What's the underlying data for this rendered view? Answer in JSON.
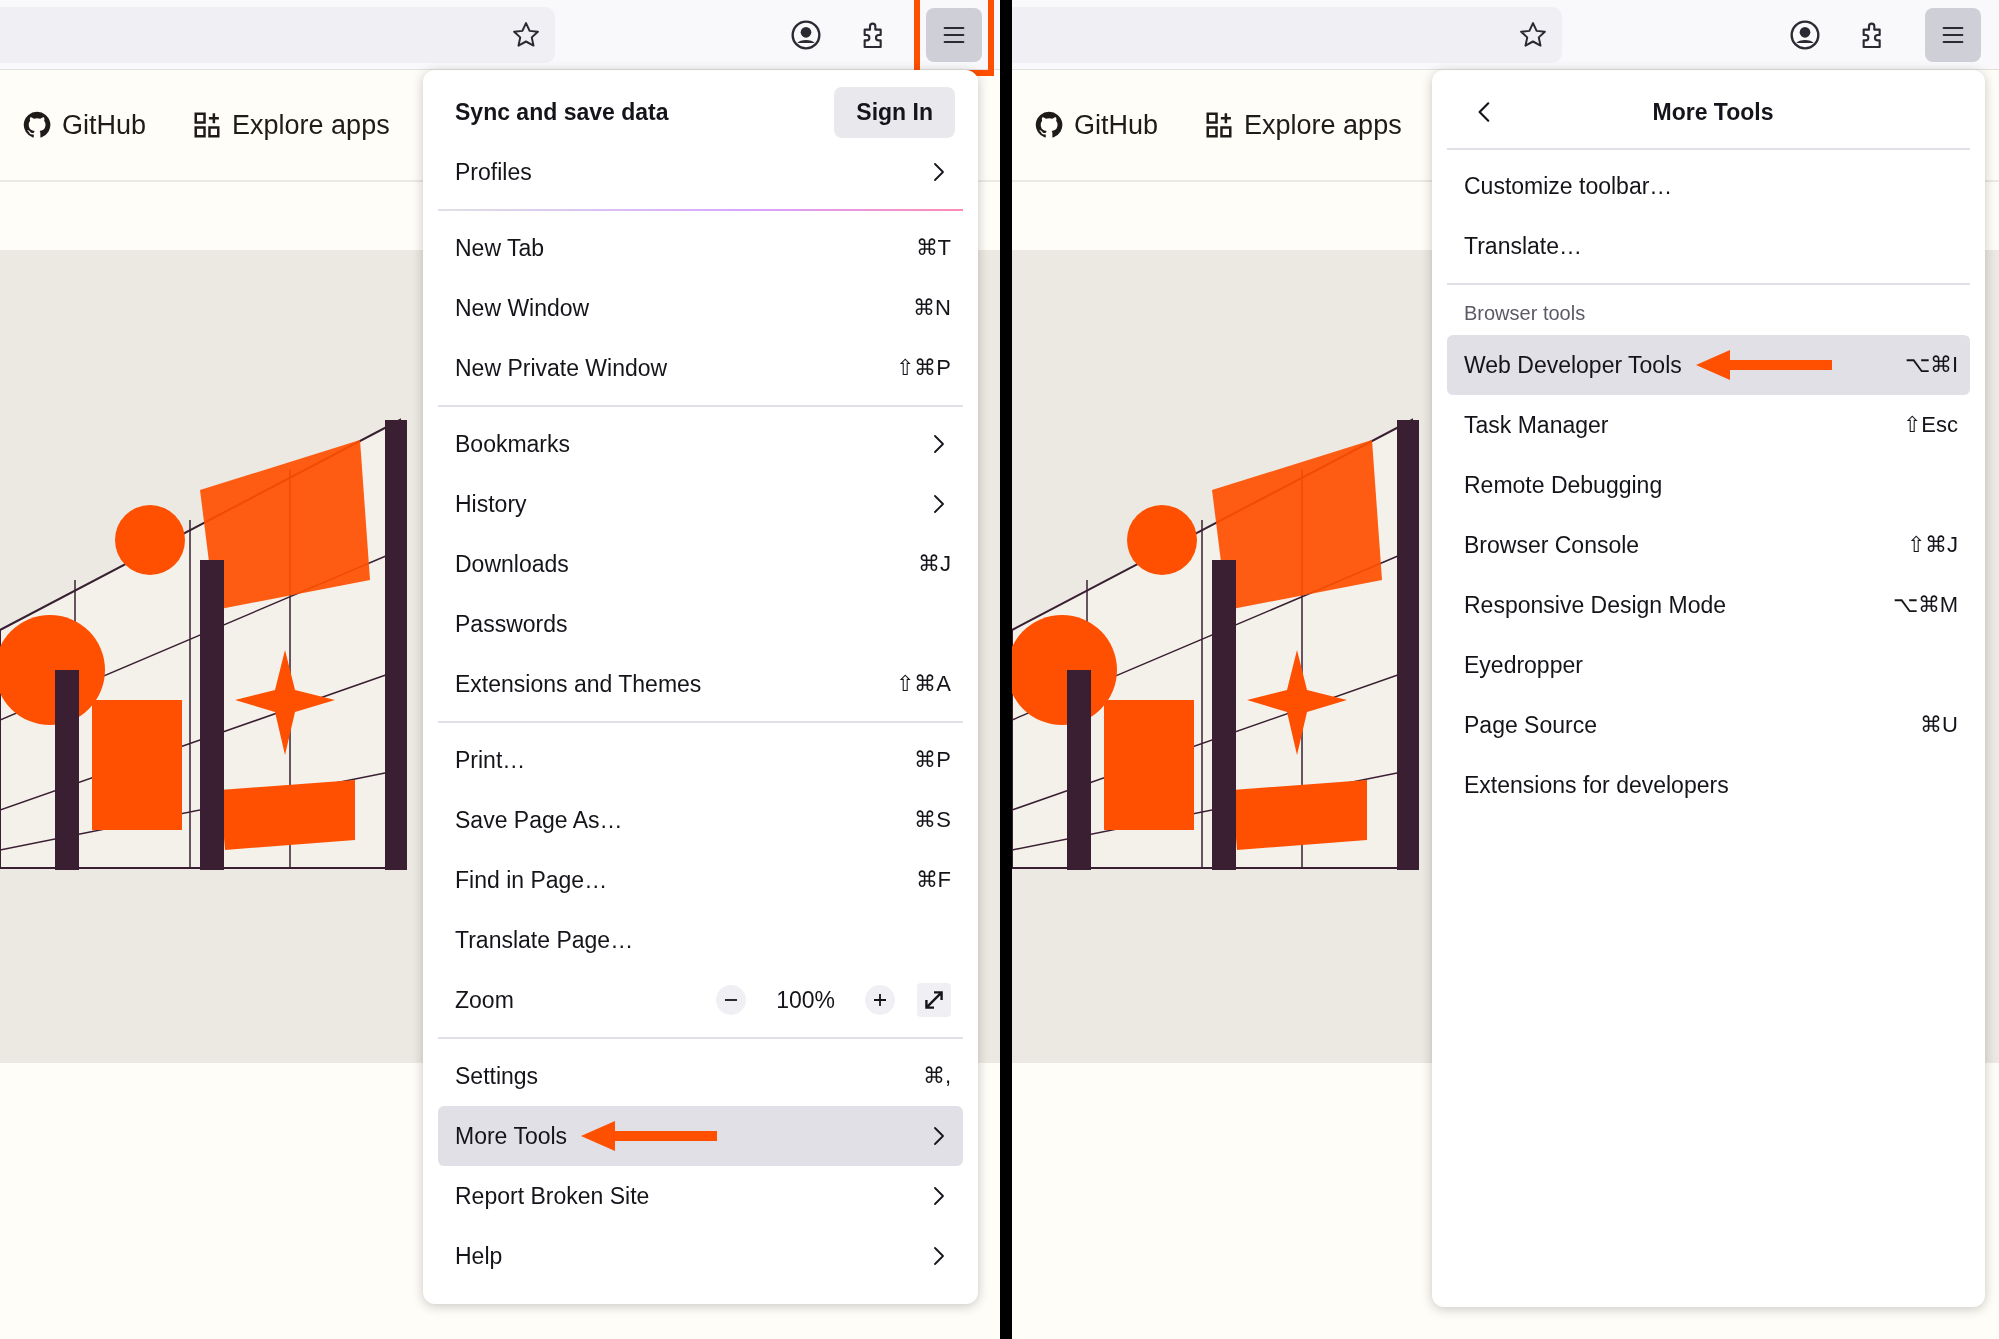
{
  "windows": [
    {
      "toolbar": {
        "menu_button_highlighted": true
      },
      "nav_links": [
        {
          "label": "GitHub",
          "kind": "github"
        },
        {
          "label": "Explore apps",
          "kind": "apps"
        }
      ],
      "menu": {
        "header": {
          "kind": "sync",
          "title": "Sync and save data",
          "button": "Sign In"
        },
        "sections": [
          {
            "items": [
              {
                "kind": "submenu",
                "label": "Profiles",
                "selected": false,
                "callout": false
              }
            ]
          },
          {
            "items": [
              {
                "kind": "action",
                "label": "New Tab",
                "shortcut": "⌘T",
                "selected": false,
                "callout": false
              },
              {
                "kind": "action",
                "label": "New Window",
                "shortcut": "⌘N",
                "selected": false,
                "callout": false
              },
              {
                "kind": "action",
                "label": "New Private Window",
                "shortcut": "⇧⌘P",
                "selected": false,
                "callout": false
              }
            ]
          },
          {
            "items": [
              {
                "kind": "submenu",
                "label": "Bookmarks",
                "selected": false,
                "callout": false
              },
              {
                "kind": "submenu",
                "label": "History",
                "selected": false,
                "callout": false
              },
              {
                "kind": "action",
                "label": "Downloads",
                "shortcut": "⌘J",
                "selected": false,
                "callout": false
              },
              {
                "kind": "action",
                "label": "Passwords",
                "selected": false,
                "callout": false
              },
              {
                "kind": "action",
                "label": "Extensions and Themes",
                "shortcut": "⇧⌘A",
                "selected": false,
                "callout": false
              }
            ]
          },
          {
            "items": [
              {
                "kind": "action",
                "label": "Print…",
                "shortcut": "⌘P",
                "selected": false,
                "callout": false
              },
              {
                "kind": "action",
                "label": "Save Page As…",
                "shortcut": "⌘S",
                "selected": false,
                "callout": false
              },
              {
                "kind": "action",
                "label": "Find in Page…",
                "shortcut": "⌘F",
                "selected": false,
                "callout": false
              },
              {
                "kind": "action",
                "label": "Translate Page…",
                "selected": false,
                "callout": false
              },
              {
                "kind": "zoom",
                "label": "Zoom",
                "value": "100%",
                "selected": false,
                "callout": false
              }
            ]
          },
          {
            "items": [
              {
                "kind": "action",
                "label": "Settings",
                "shortcut": "⌘,",
                "selected": false,
                "callout": false
              },
              {
                "kind": "submenu",
                "label": "More Tools",
                "selected": true,
                "callout": true
              },
              {
                "kind": "submenu",
                "label": "Report Broken Site",
                "selected": false,
                "callout": false
              },
              {
                "kind": "submenu",
                "label": "Help",
                "selected": false,
                "callout": false
              }
            ]
          }
        ]
      }
    },
    {
      "toolbar": {
        "menu_button_highlighted": false
      },
      "nav_links": [
        {
          "label": "GitHub",
          "kind": "github"
        },
        {
          "label": "Explore apps",
          "kind": "apps"
        }
      ],
      "menu": {
        "header": {
          "kind": "subview",
          "title": "More Tools"
        },
        "sections": [
          {
            "items": [
              {
                "kind": "action",
                "label": "Customize toolbar…",
                "selected": false,
                "callout": false
              },
              {
                "kind": "action",
                "label": "Translate…",
                "selected": false,
                "callout": false
              }
            ]
          },
          {
            "heading": "Browser tools",
            "items": [
              {
                "kind": "action",
                "label": "Web Developer Tools",
                "shortcut": "⌥⌘I",
                "selected": true,
                "callout": true
              },
              {
                "kind": "action",
                "label": "Task Manager",
                "shortcut": "⇧Esc",
                "selected": false,
                "callout": false
              },
              {
                "kind": "action",
                "label": "Remote Debugging",
                "selected": false,
                "callout": false
              },
              {
                "kind": "action",
                "label": "Browser Console",
                "shortcut": "⇧⌘J",
                "selected": false,
                "callout": false
              },
              {
                "kind": "action",
                "label": "Responsive Design Mode",
                "shortcut": "⌥⌘M",
                "selected": false,
                "callout": false
              },
              {
                "kind": "action",
                "label": "Eyedropper",
                "selected": false,
                "callout": false
              },
              {
                "kind": "action",
                "label": "Page Source",
                "shortcut": "⌘U",
                "selected": false,
                "callout": false
              },
              {
                "kind": "action",
                "label": "Extensions for developers",
                "selected": false,
                "callout": false
              }
            ]
          }
        ]
      }
    }
  ]
}
